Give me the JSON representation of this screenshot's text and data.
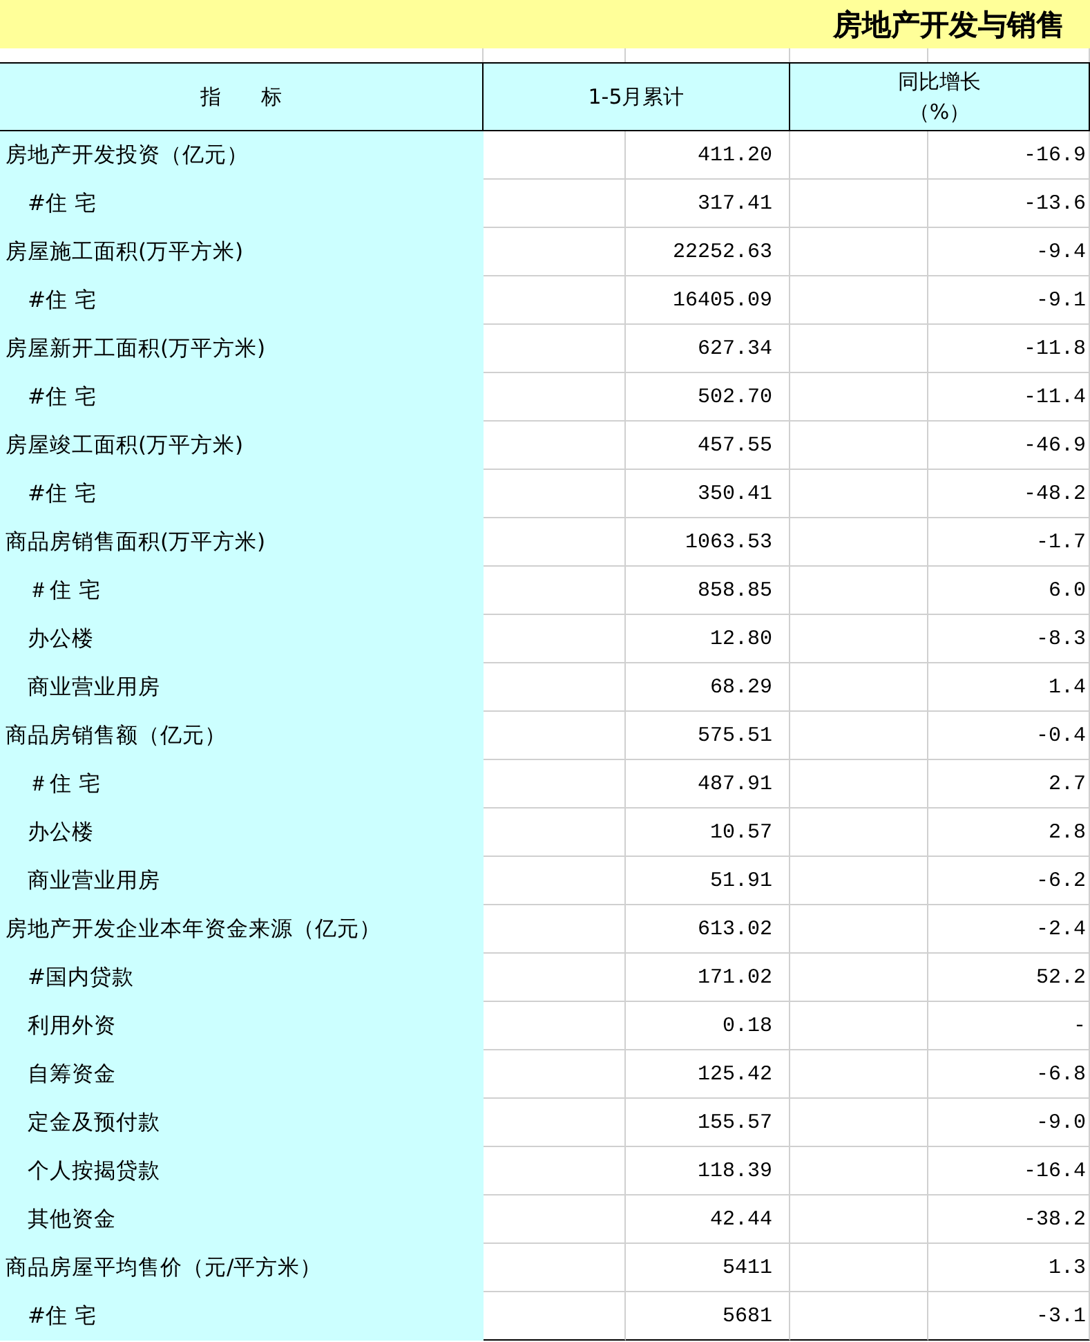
{
  "title": "房地产开发与销售",
  "columns": [
    {
      "label": "指      标"
    },
    {
      "label": "1-5月累计"
    },
    {
      "label": "同比增长",
      "unit": "（%）"
    }
  ],
  "rows": [
    {
      "label": "房地产开发投资（亿元）",
      "value": "411.20",
      "change": "-16.9",
      "children": [
        {
          "label": "#住 宅",
          "value": "317.41",
          "change": "-13.6"
        }
      ]
    },
    {
      "label": "房屋施工面积(万平方米)",
      "value": "22252.63",
      "change": "-9.4",
      "children": [
        {
          "label": "#住 宅",
          "value": "16405.09",
          "change": "-9.1"
        }
      ]
    },
    {
      "label": "房屋新开工面积(万平方米)",
      "value": "627.34",
      "change": "-11.8",
      "children": [
        {
          "label": "#住 宅",
          "value": "502.70",
          "change": "-11.4"
        }
      ]
    },
    {
      "label": "房屋竣工面积(万平方米)",
      "value": "457.55",
      "change": "-46.9",
      "children": [
        {
          "label": "#住 宅",
          "value": "350.41",
          "change": "-48.2"
        }
      ]
    },
    {
      "label": "商品房销售面积(万平方米)",
      "value": "1063.53",
      "change": "-1.7",
      "children": [
        {
          "label": "＃住 宅",
          "value": "858.85",
          "change": "6.0"
        },
        {
          "label": "办公楼",
          "value": "12.80",
          "change": "-8.3"
        },
        {
          "label": "商业营业用房",
          "value": "68.29",
          "change": "1.4"
        }
      ]
    },
    {
      "label": "商品房销售额（亿元）",
      "value": "575.51",
      "change": "-0.4",
      "children": [
        {
          "label": "＃住 宅",
          "value": "487.91",
          "change": "2.7"
        },
        {
          "label": "办公楼",
          "value": "10.57",
          "change": "2.8"
        },
        {
          "label": "商业营业用房",
          "value": "51.91",
          "change": "-6.2"
        }
      ]
    },
    {
      "label": "房地产开发企业本年资金来源（亿元）",
      "value": "613.02",
      "change": "-2.4",
      "children": [
        {
          "label": "#国内贷款",
          "value": "171.02",
          "change": "52.2"
        },
        {
          "label": "利用外资",
          "value": "0.18",
          "change": "-"
        },
        {
          "label": "自筹资金",
          "value": "125.42",
          "change": "-6.8"
        },
        {
          "label": "定金及预付款",
          "value": "155.57",
          "change": "-9.0"
        },
        {
          "label": "个人按揭贷款",
          "value": "118.39",
          "change": "-16.4"
        },
        {
          "label": "其他资金",
          "value": "42.44",
          "change": "-38.2"
        }
      ]
    },
    {
      "label": "商品房屋平均售价（元/平方米）",
      "value": "5411",
      "change": "1.3",
      "children": [
        {
          "label": "#住 宅",
          "value": "5681",
          "change": "-3.1"
        }
      ]
    }
  ]
}
